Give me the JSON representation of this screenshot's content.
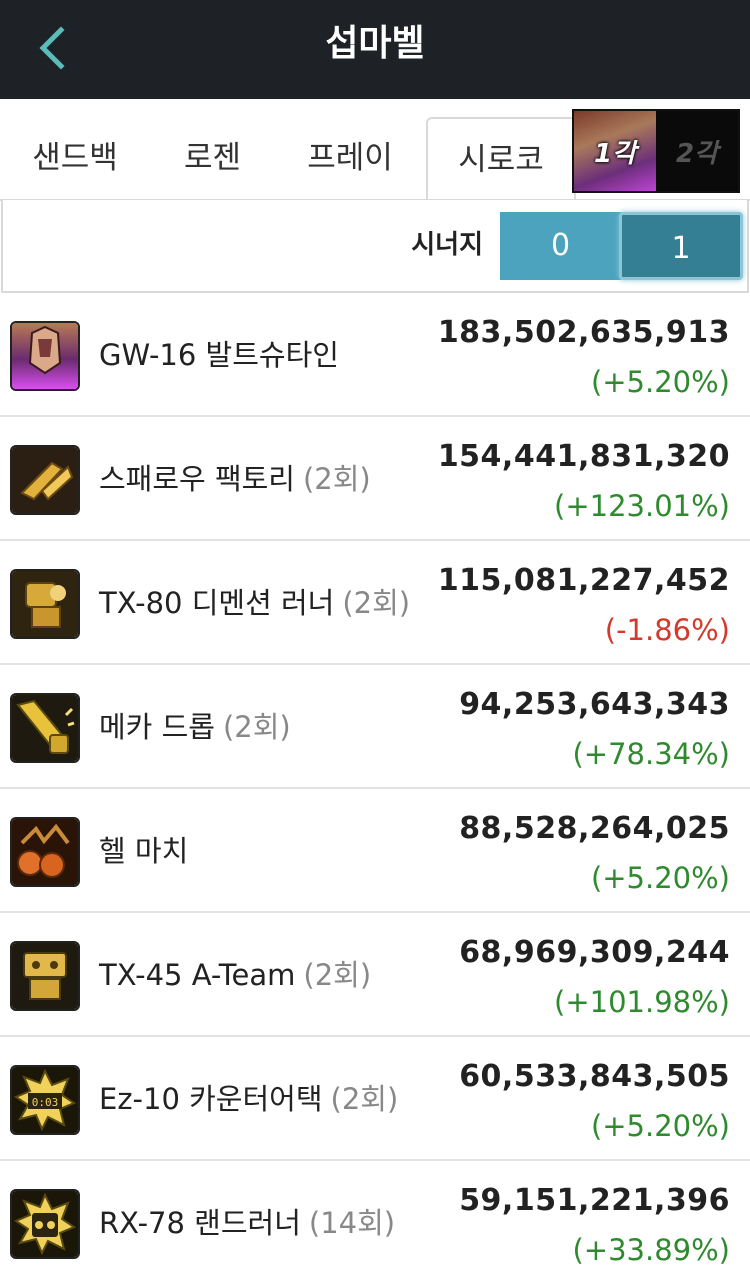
{
  "header": {
    "title": "섭마벨",
    "back_icon": "chevron-left-icon"
  },
  "tabs": [
    {
      "label": "샌드백",
      "active": false
    },
    {
      "label": "로젠",
      "active": false
    },
    {
      "label": "프레이",
      "active": false
    },
    {
      "label": "시로코",
      "active": true
    }
  ],
  "core_toggle": {
    "left_label": "1각",
    "right_label": "2각",
    "selected": "1각"
  },
  "synergy": {
    "label": "시너지",
    "options": [
      "0",
      "1"
    ],
    "selected": "1"
  },
  "colors": {
    "header_bg": "#1e2227",
    "accent": "#4ba3bd",
    "accent_selected": "#357f94",
    "positive": "#2f8a2f",
    "negative": "#d33a2c"
  },
  "skills": [
    {
      "name": "GW-16 발트슈타인",
      "count": "",
      "value": "183,502,635,913",
      "change": "(+5.20%)",
      "trend": "up",
      "icon": "waltstein-icon"
    },
    {
      "name": "스패로우 팩토리",
      "count": "(2회)",
      "value": "154,441,831,320",
      "change": "(+123.01%)",
      "trend": "up",
      "icon": "sparrow-factory-icon"
    },
    {
      "name": "TX-80 디멘션 러너",
      "count": "(2회)",
      "value": "115,081,227,452",
      "change": "(-1.86%)",
      "trend": "down",
      "icon": "dimension-runner-icon"
    },
    {
      "name": "메카 드롭",
      "count": "(2회)",
      "value": "94,253,643,343",
      "change": "(+78.34%)",
      "trend": "up",
      "icon": "mecha-drop-icon"
    },
    {
      "name": "헬 마치",
      "count": "",
      "value": "88,528,264,025",
      "change": "(+5.20%)",
      "trend": "up",
      "icon": "hell-march-icon"
    },
    {
      "name": "TX-45 A-Team",
      "count": "(2회)",
      "value": "68,969,309,244",
      "change": "(+101.98%)",
      "trend": "up",
      "icon": "a-team-icon"
    },
    {
      "name": "Ez-10 카운터어택",
      "count": "(2회)",
      "value": "60,533,843,505",
      "change": "(+5.20%)",
      "trend": "up",
      "icon": "counter-attack-icon"
    },
    {
      "name": "RX-78 랜드러너",
      "count": "(14회)",
      "value": "59,151,221,396",
      "change": "(+33.89%)",
      "trend": "up",
      "icon": "land-runner-icon"
    }
  ]
}
